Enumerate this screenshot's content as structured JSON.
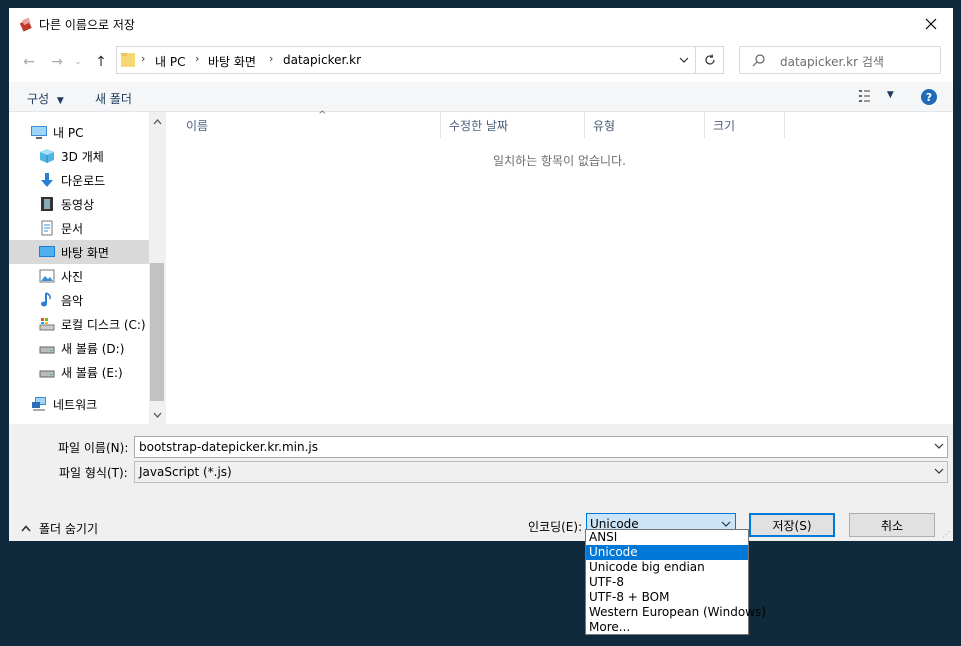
{
  "window": {
    "title": "다른 이름으로 저장"
  },
  "address": {
    "crumbs": [
      "내 PC",
      "바탕 화면",
      "datapicker.kr"
    ]
  },
  "search": {
    "placeholder": "datapicker.kr 검색"
  },
  "toolbar": {
    "organize": "구성",
    "new_folder": "새 폴더"
  },
  "nav": {
    "items": [
      {
        "label": "내 PC",
        "icon": "computer-icon"
      },
      {
        "label": "3D 개체",
        "icon": "cube-3d-icon"
      },
      {
        "label": "다운로드",
        "icon": "download-arrow-icon"
      },
      {
        "label": "동영상",
        "icon": "film-icon"
      },
      {
        "label": "문서",
        "icon": "document-icon"
      },
      {
        "label": "바탕 화면",
        "icon": "desktop-icon"
      },
      {
        "label": "사진",
        "icon": "picture-icon"
      },
      {
        "label": "음악",
        "icon": "music-note-icon"
      },
      {
        "label": "로컬 디스크 (C:)",
        "icon": "local-disk-icon"
      },
      {
        "label": "새 볼륨 (D:)",
        "icon": "drive-icon"
      },
      {
        "label": "새 볼륨 (E:)",
        "icon": "drive-icon"
      },
      {
        "label": "네트워크",
        "icon": "network-icon"
      }
    ]
  },
  "columns": [
    "이름",
    "수정한 날짜",
    "유형",
    "크기"
  ],
  "empty_message": "일치하는 항목이 없습니다.",
  "form": {
    "filename_label": "파일 이름(N):",
    "filename_value": "bootstrap-datepicker.kr.min.js",
    "filetype_label": "파일 형식(T):",
    "filetype_value": "JavaScript (*.js)",
    "encoding_label": "인코딩(E):",
    "encoding_value": "Unicode",
    "save_label": "저장(S)",
    "cancel_label": "취소",
    "hide_folders_label": "폴더 숨기기"
  },
  "encoding_options": [
    "ANSI",
    "Unicode",
    "Unicode big endian",
    "UTF-8",
    "UTF-8 + BOM",
    "Western European (Windows)",
    "More..."
  ],
  "colors": {
    "accent": "#0078d7",
    "selection": "#d9d9d9",
    "help": "#1e6bb8"
  }
}
